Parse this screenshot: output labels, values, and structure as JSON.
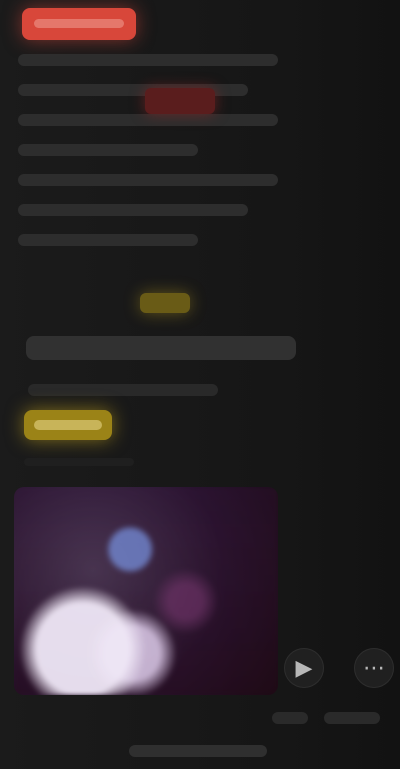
{
  "screen": {
    "title": "",
    "subtitle": ""
  },
  "controls": {
    "left_action": "▶",
    "right_action": "⋯"
  }
}
